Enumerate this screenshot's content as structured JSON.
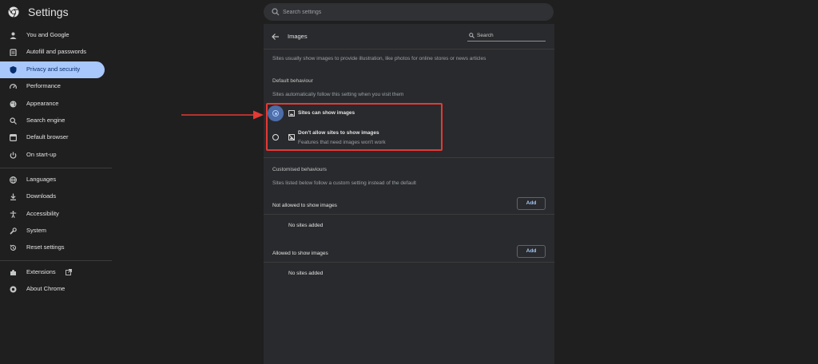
{
  "app": {
    "title": "Settings",
    "search_placeholder": "Search settings"
  },
  "sidebar": {
    "items": [
      {
        "label": "You and Google",
        "icon": "person-icon"
      },
      {
        "label": "Autofill and passwords",
        "icon": "clipboard-icon"
      },
      {
        "label": "Privacy and security",
        "icon": "shield-icon",
        "active": true
      },
      {
        "label": "Performance",
        "icon": "speedometer-icon"
      },
      {
        "label": "Appearance",
        "icon": "palette-icon"
      },
      {
        "label": "Search engine",
        "icon": "search-icon"
      },
      {
        "label": "Default browser",
        "icon": "browser-icon"
      },
      {
        "label": "On start-up",
        "icon": "power-icon"
      },
      {
        "label": "Languages",
        "icon": "globe-icon"
      },
      {
        "label": "Downloads",
        "icon": "download-icon"
      },
      {
        "label": "Accessibility",
        "icon": "accessibility-icon"
      },
      {
        "label": "System",
        "icon": "wrench-icon"
      },
      {
        "label": "Reset settings",
        "icon": "reset-icon"
      },
      {
        "label": "Extensions",
        "icon": "puzzle-icon"
      },
      {
        "label": "About Chrome",
        "icon": "chrome-icon"
      }
    ]
  },
  "page": {
    "title": "Images",
    "search_placeholder": "Search",
    "description": "Sites usually show images to provide illustration, like photos for online stores or news articles",
    "default_behaviour": {
      "heading": "Default behaviour",
      "subtitle": "Sites automatically follow this setting when you visit them",
      "options": [
        {
          "label": "Sites can show images",
          "selected": true,
          "icon": "image-icon"
        },
        {
          "label": "Don't allow sites to show images",
          "sublabel": "Features that need images won't work",
          "selected": false,
          "icon": "image-blocked-icon"
        }
      ]
    },
    "customised": {
      "heading": "Customised behaviours",
      "subtitle": "Sites listed below follow a custom setting instead of the default",
      "not_allowed": {
        "label": "Not allowed to show images",
        "button": "Add",
        "empty": "No sites added"
      },
      "allowed": {
        "label": "Allowed to show images",
        "button": "Add",
        "empty": "No sites added"
      }
    }
  },
  "colors": {
    "background": "#1f1f1f",
    "panel": "#292a2d",
    "accent": "#a8c7fa",
    "annotation": "#e53935"
  }
}
